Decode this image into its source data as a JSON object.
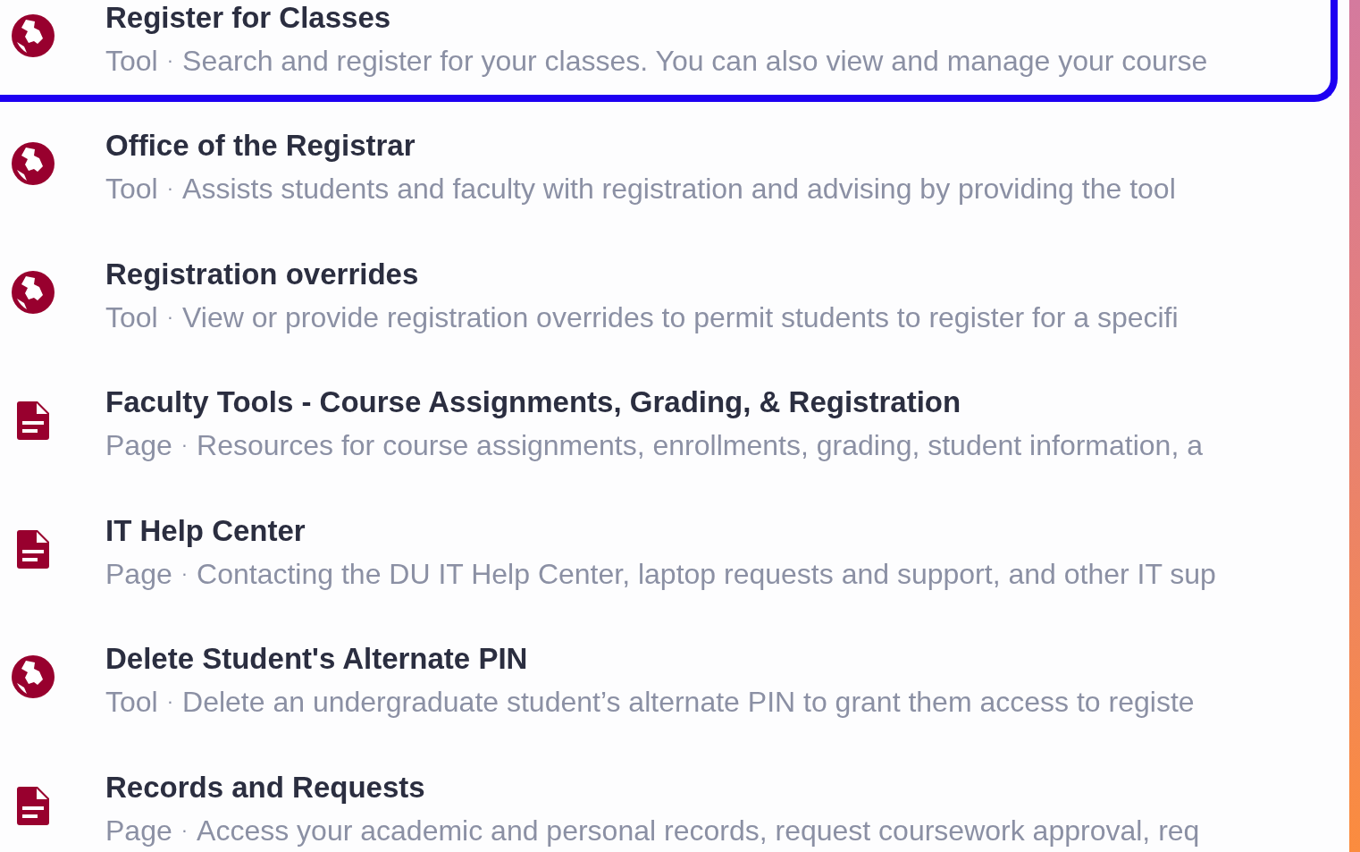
{
  "results": [
    {
      "kind": "tool",
      "selected": true,
      "title": "Register for Classes",
      "type": "Tool",
      "separator": "·",
      "description": "Search and register for your classes. You can also view and manage your course"
    },
    {
      "kind": "tool",
      "selected": false,
      "title": "Office of the Registrar",
      "type": "Tool",
      "separator": "·",
      "description": "Assists students and faculty with registration and advising by providing the tool"
    },
    {
      "kind": "tool",
      "selected": false,
      "title": "Registration overrides",
      "type": "Tool",
      "separator": "·",
      "description": "View or provide registration overrides to permit students to register for a specifi"
    },
    {
      "kind": "page",
      "selected": false,
      "title": "Faculty Tools - Course Assignments, Grading, & Registration",
      "type": "Page",
      "separator": "·",
      "description": "Resources for course assignments, enrollments, grading, student information, a"
    },
    {
      "kind": "page",
      "selected": false,
      "title": "IT Help Center",
      "type": "Page",
      "separator": "·",
      "description": "Contacting the DU IT Help Center, laptop requests and support, and other IT sup"
    },
    {
      "kind": "tool",
      "selected": false,
      "title": "Delete Student's Alternate PIN",
      "type": "Tool",
      "separator": "·",
      "description": "Delete an undergraduate student’s alternate PIN to grant them access to registe"
    },
    {
      "kind": "page",
      "selected": false,
      "title": "Records and Requests",
      "type": "Page",
      "separator": "·",
      "description": "Access your academic and personal records, request coursework approval, req"
    }
  ]
}
